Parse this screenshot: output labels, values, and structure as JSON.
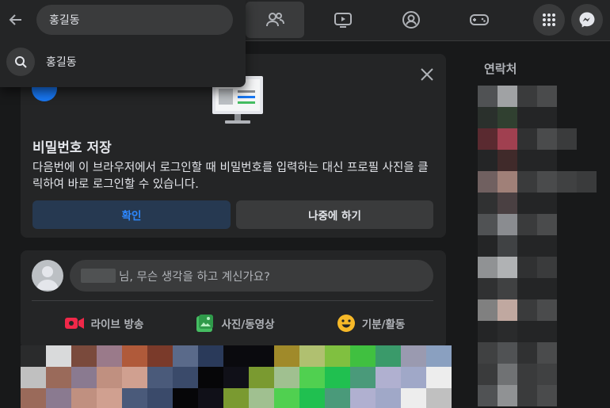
{
  "search": {
    "query": "홍길동",
    "suggestion": "홍길동"
  },
  "password_prompt": {
    "title": "비밀번호 저장",
    "description": "다음번에 이 브라우저에서 로그인할 때 비밀번호를 입력하는 대신 프로필 사진을 클릭하여 바로 로그인할 수 있습니다.",
    "confirm_label": "확인",
    "later_label": "나중에 하기"
  },
  "composer": {
    "prompt": "님, 무슨 생각을 하고 계신가요?",
    "actions": [
      {
        "label": "라이브 방송",
        "icon": "live-video-icon",
        "color": "#f02849"
      },
      {
        "label": "사진/동영상",
        "icon": "photo-video-icon",
        "color": "#45bd62"
      },
      {
        "label": "기분/활동",
        "icon": "feeling-icon",
        "color": "#f7b928"
      }
    ]
  },
  "sidebar": {
    "contacts_title": "연락처"
  },
  "nav": {
    "tabs": [
      "friends-icon",
      "watch-icon",
      "groups-icon",
      "gaming-icon"
    ],
    "right_buttons": [
      "menu-grid-icon",
      "messenger-icon"
    ]
  },
  "colors": {
    "background": "#18191a",
    "surface": "#242526",
    "accent": "#2d88ff"
  }
}
